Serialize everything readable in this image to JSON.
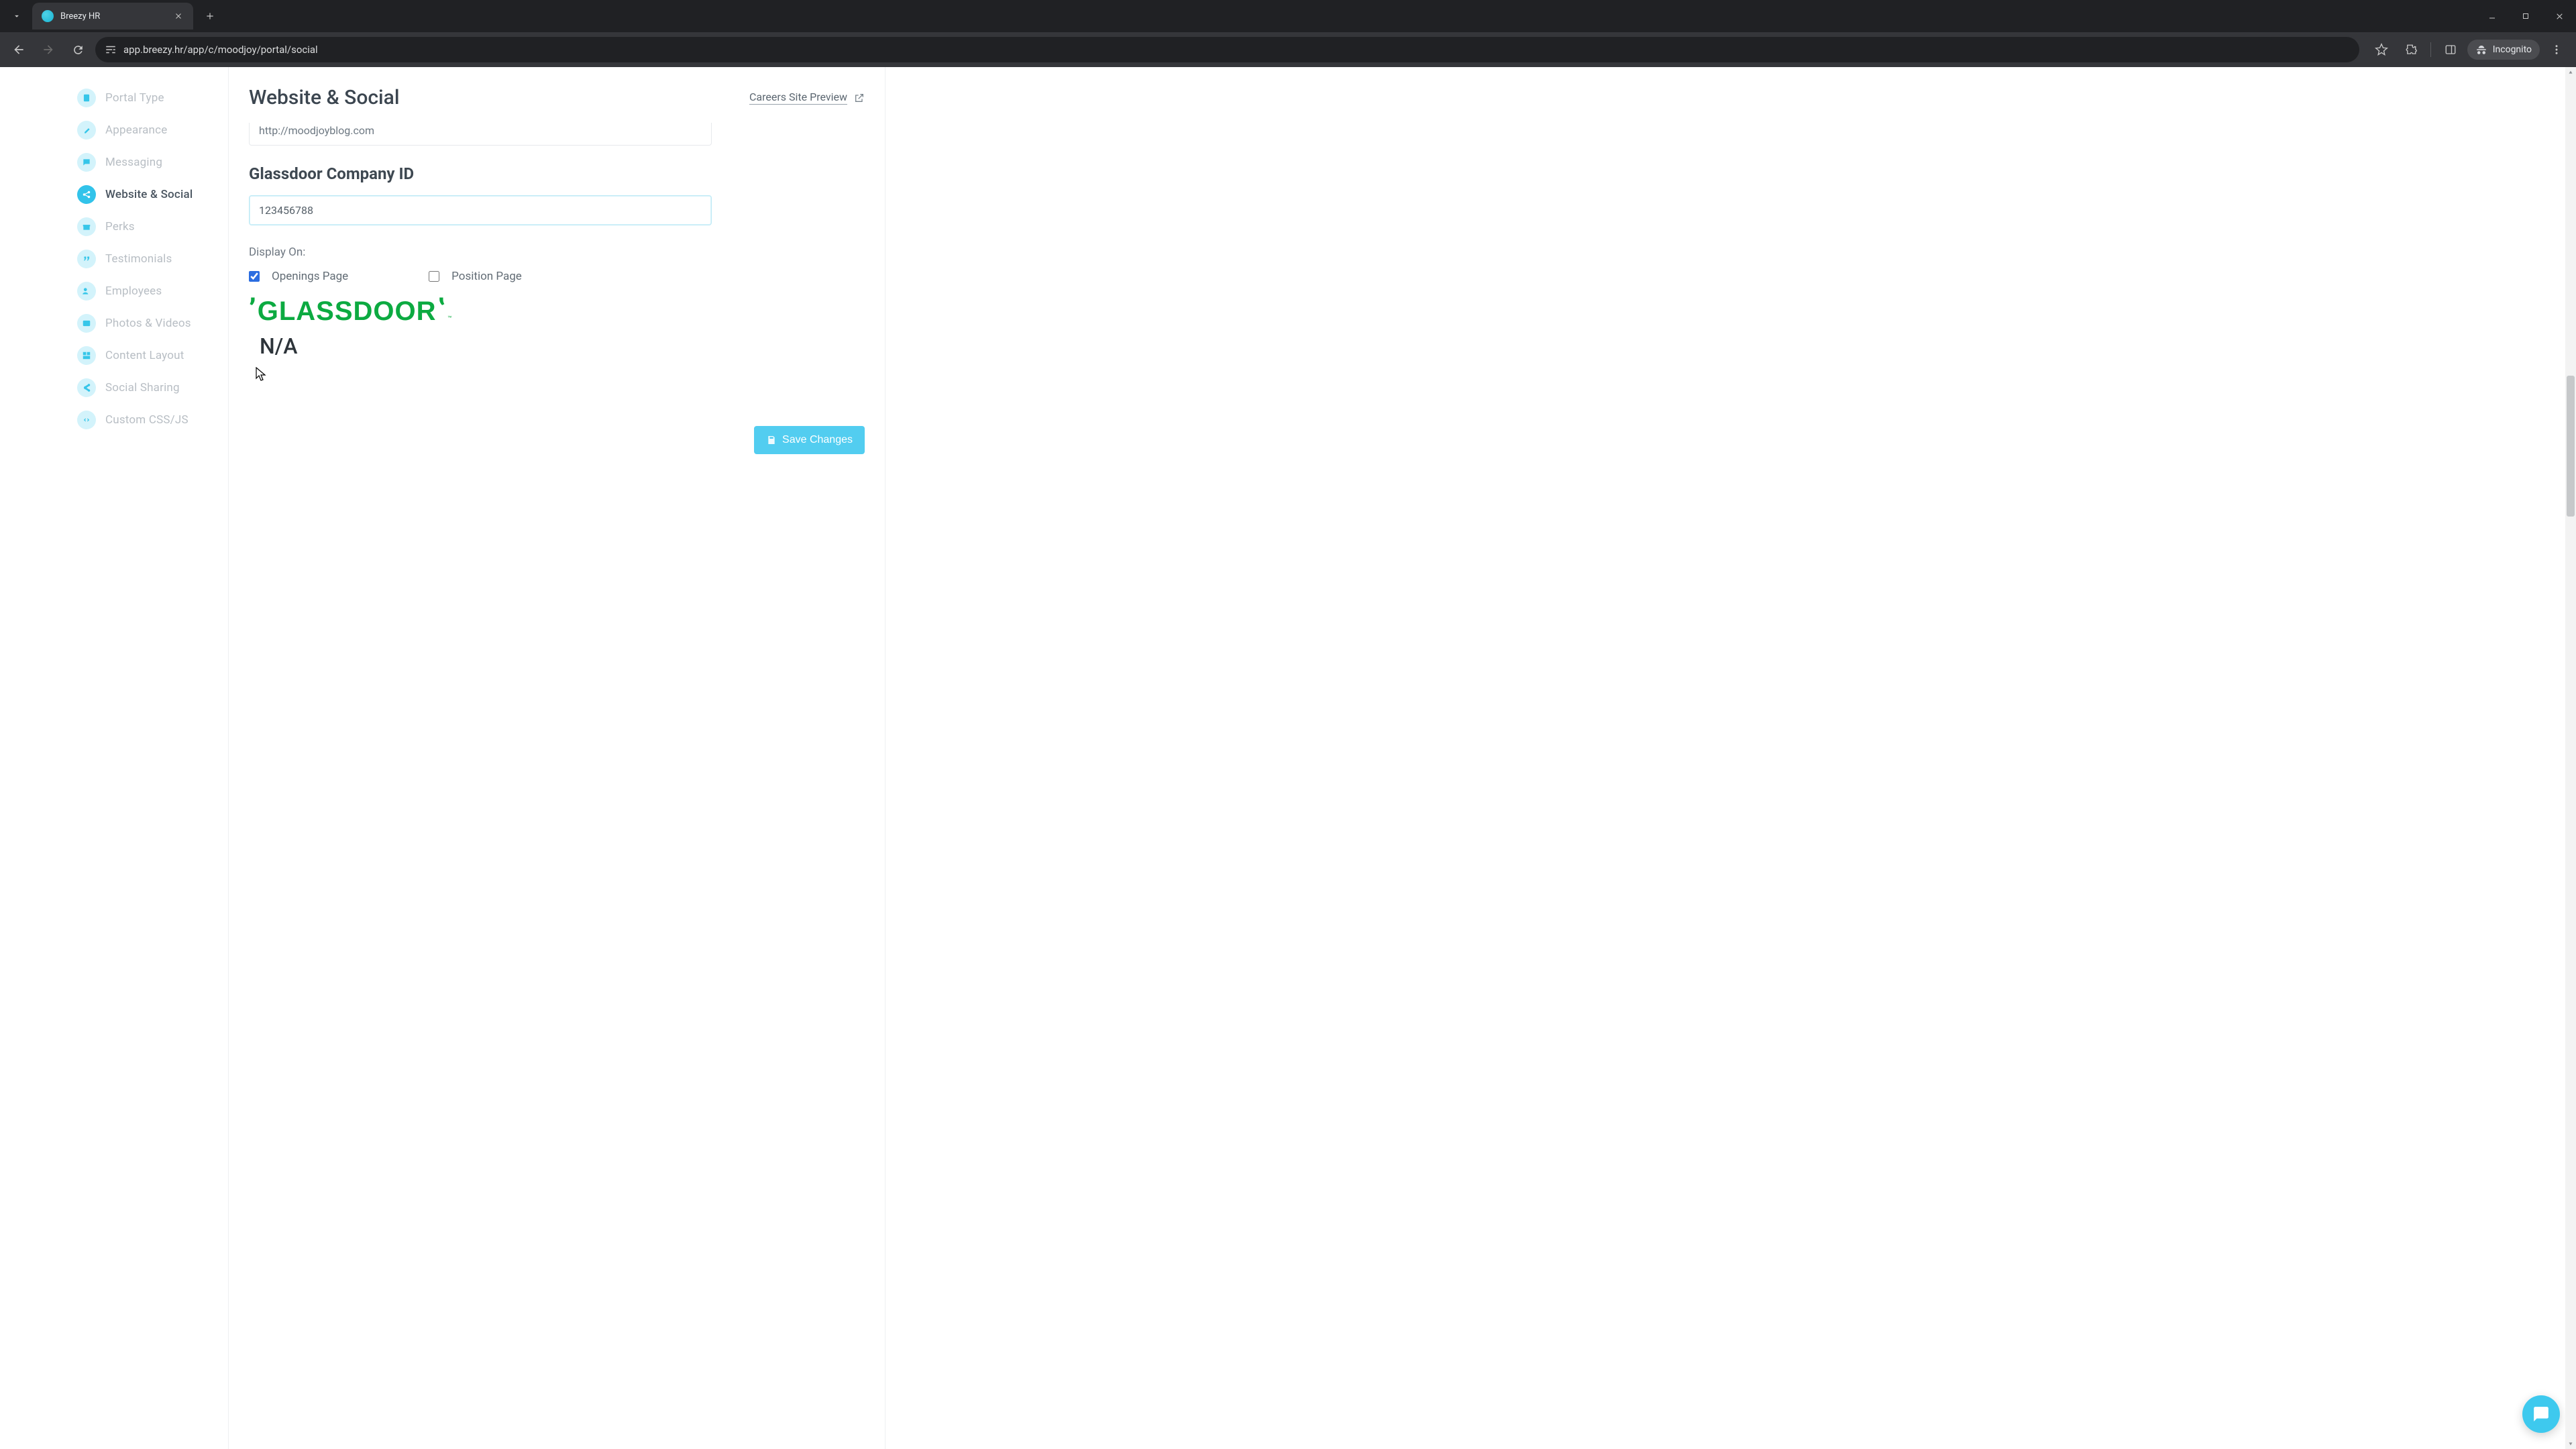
{
  "browser": {
    "tab_title": "Breezy HR",
    "url": "app.breezy.hr/app/c/moodjoy/portal/social",
    "incognito_label": "Incognito"
  },
  "sidebar": {
    "items": [
      {
        "label": "Portal Type"
      },
      {
        "label": "Appearance"
      },
      {
        "label": "Messaging"
      },
      {
        "label": "Website & Social"
      },
      {
        "label": "Perks"
      },
      {
        "label": "Testimonials"
      },
      {
        "label": "Employees"
      },
      {
        "label": "Photos & Videos"
      },
      {
        "label": "Content Layout"
      },
      {
        "label": "Social Sharing"
      },
      {
        "label": "Custom CSS/JS"
      }
    ]
  },
  "header": {
    "title": "Website & Social",
    "preview_label": "Careers Site Preview"
  },
  "form": {
    "blog_url": "http://moodjoyblog.com",
    "glassdoor_label": "Glassdoor Company ID",
    "glassdoor_id": "123456788",
    "display_on_label": "Display On:",
    "checkbox_openings": "Openings Page",
    "checkbox_position": "Position Page",
    "glassdoor_word": "GLASSDOOR",
    "glassdoor_tm": "™",
    "glassdoor_rating": "N/A",
    "save_label": "Save Changes"
  }
}
